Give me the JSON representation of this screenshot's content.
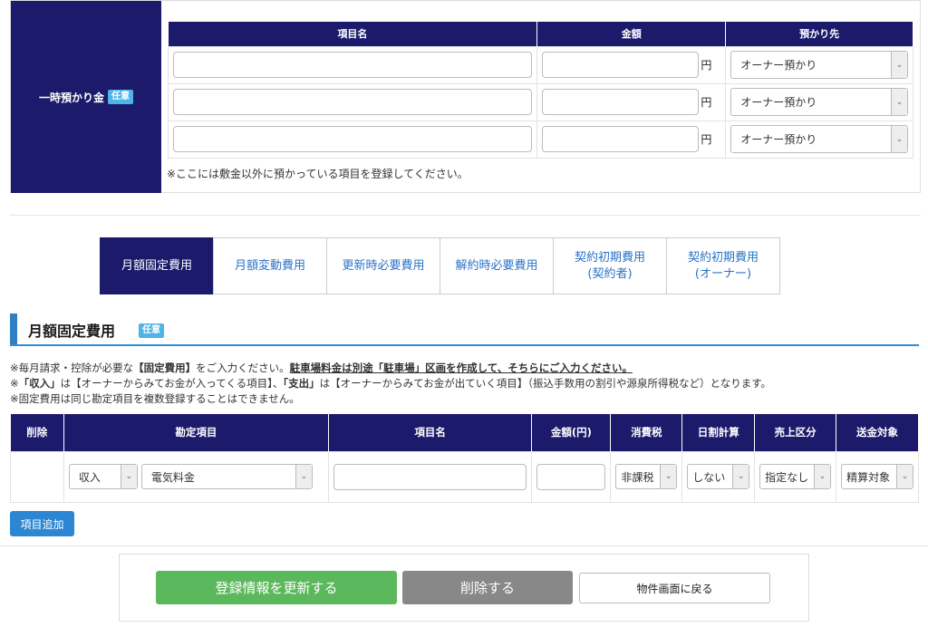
{
  "deposit": {
    "label": "一時預かり金",
    "badge": "任意",
    "columns": [
      "項目名",
      "金額",
      "預かり先"
    ],
    "unit": "円",
    "rows": [
      {
        "name": "",
        "amount": "",
        "destination": "オーナー預かり"
      },
      {
        "name": "",
        "amount": "",
        "destination": "オーナー預かり"
      },
      {
        "name": "",
        "amount": "",
        "destination": "オーナー預かり"
      }
    ],
    "note": "※ここには敷金以外に預かっている項目を登録してください。"
  },
  "tabs": [
    {
      "line1": "月額固定費用",
      "line2": ""
    },
    {
      "line1": "月額変動費用",
      "line2": ""
    },
    {
      "line1": "更新時必要費用",
      "line2": ""
    },
    {
      "line1": "解約時必要費用",
      "line2": ""
    },
    {
      "line1": "契約初期費用",
      "line2": "(契約者)"
    },
    {
      "line1": "契約初期費用",
      "line2": "(オーナー)"
    }
  ],
  "section": {
    "title": "月額固定費用",
    "badge": "任意",
    "desc1_a": "※毎月請求・控除が必要な",
    "desc1_b": "【固定費用】",
    "desc1_c": "をご入力ください。",
    "desc1_d": "駐車場料金は別途「駐車場」区画を作成して、そちらにご入力ください。",
    "desc2_a": "※",
    "desc2_b": "「収入」",
    "desc2_c": "は【オーナーからみてお金が入ってくる項目】、",
    "desc2_d": "「支出」",
    "desc2_e": "は【オーナーからみてお金が出ていく項目】（振込手数用の割引や源泉所得税など）となります。",
    "desc3": "※固定費用は同じ勘定項目を複数登録することはできません。"
  },
  "table": {
    "columns": [
      "削除",
      "勘定項目",
      "項目名",
      "金額(円)",
      "消費税",
      "日割計算",
      "売上区分",
      "送金対象"
    ],
    "row": {
      "type": "収入",
      "account": "電気料金",
      "name": "",
      "amount": "",
      "tax": "非課税",
      "prorate": "しない",
      "sales_category": "指定なし",
      "remit": "精算対象"
    }
  },
  "buttons": {
    "add": "項目追加",
    "update": "登録情報を更新する",
    "delete": "削除する",
    "back": "物件画面に戻る"
  },
  "colors": {
    "navy": "#1b1a6b",
    "accent": "#2f8fd6",
    "green": "#5cb85c",
    "badge": "#4fb4e6"
  }
}
